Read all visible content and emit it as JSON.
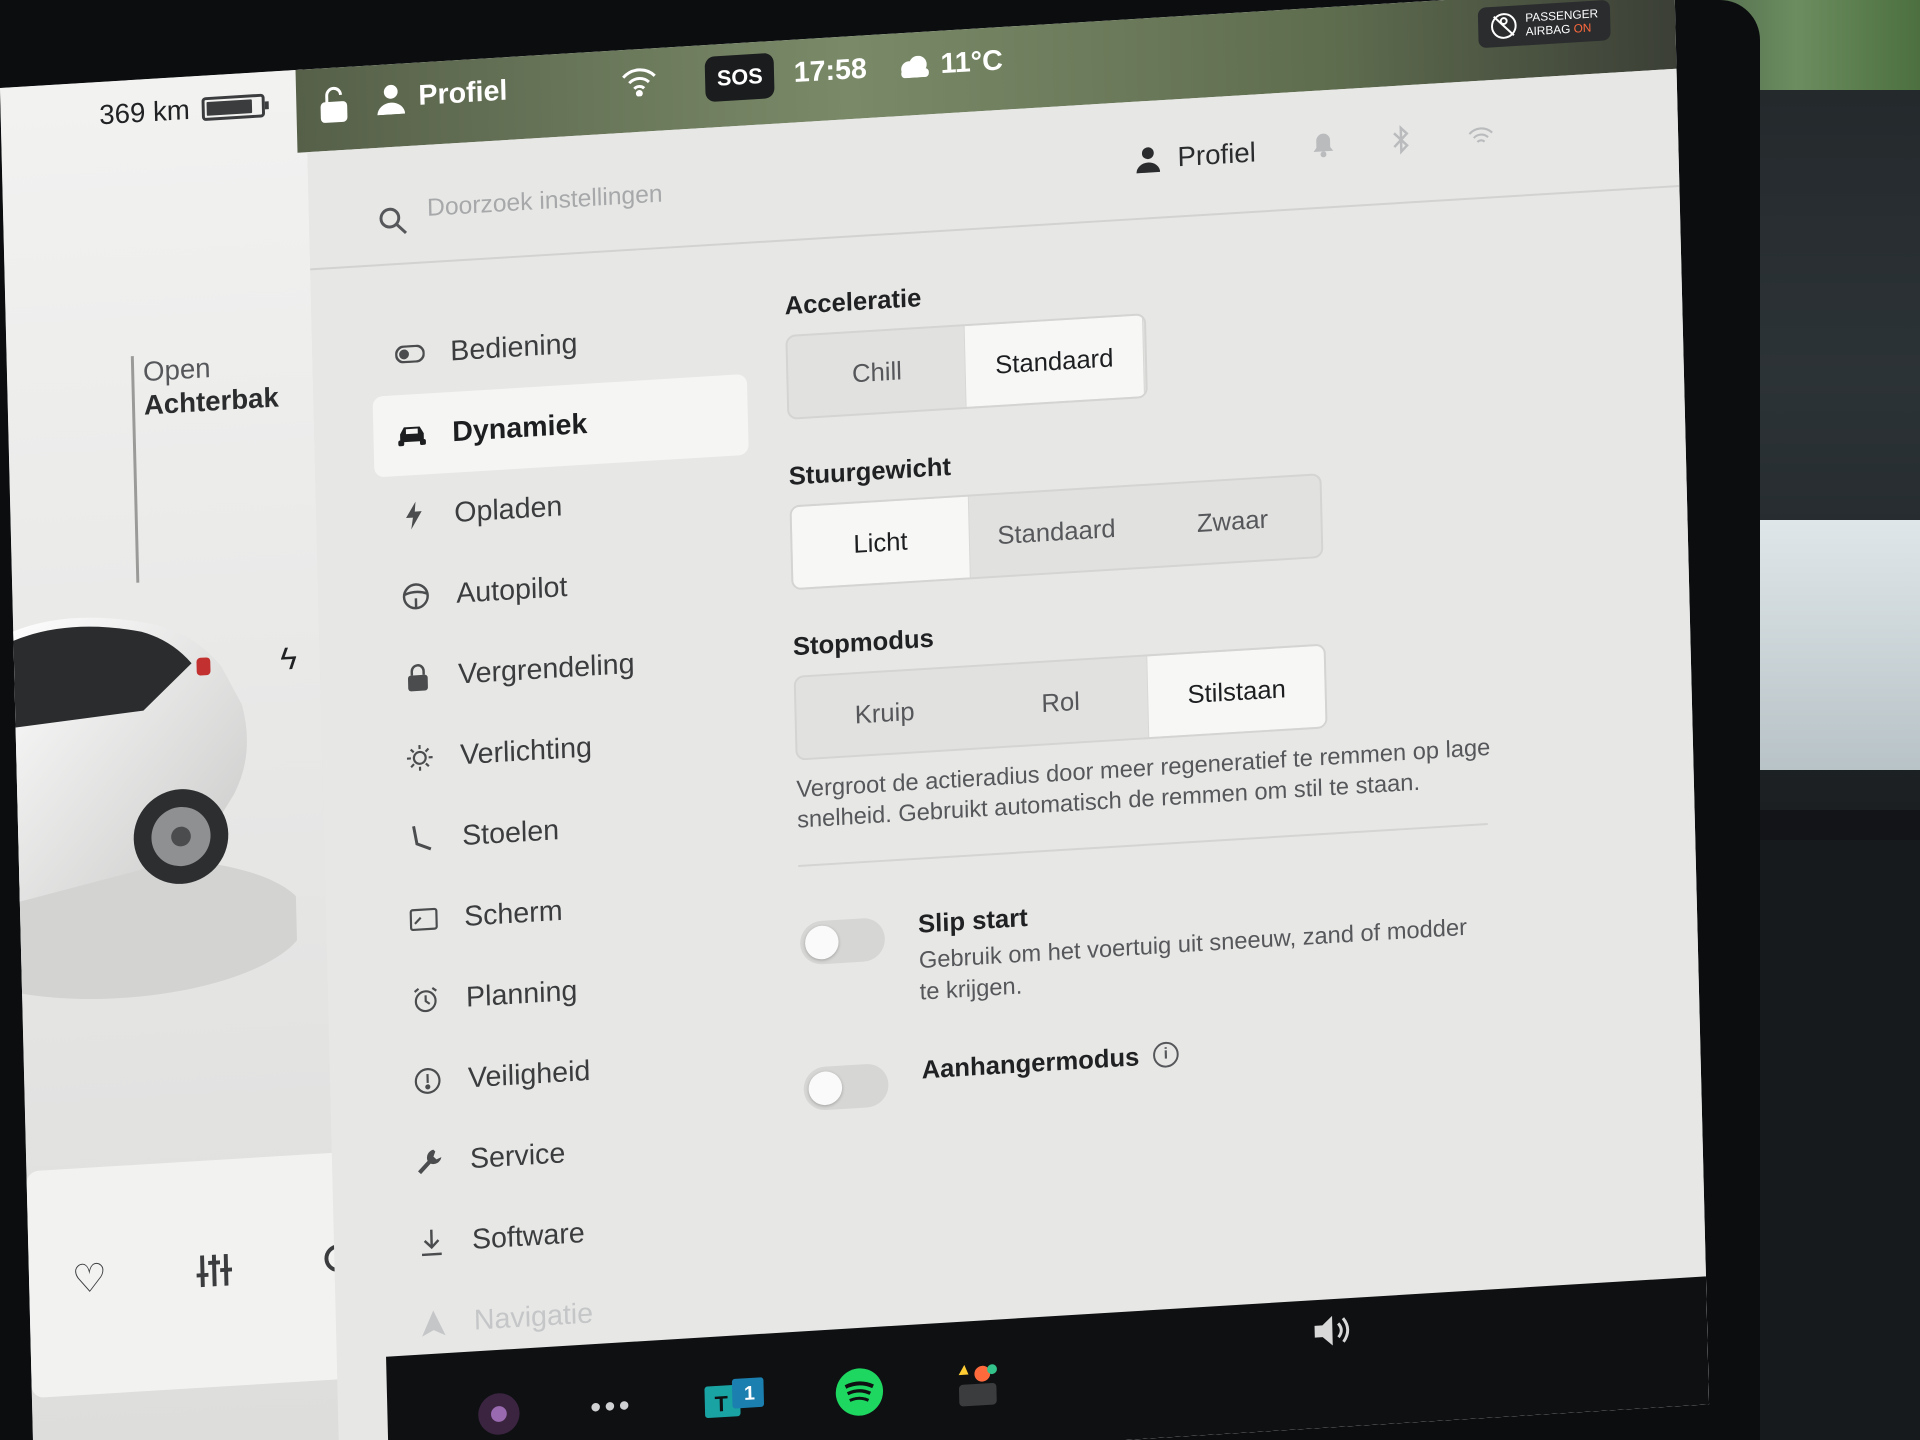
{
  "status_bar": {
    "profile_label": "Profiel",
    "sos_label": "SOS",
    "time": "17:58",
    "temperature": "11°C",
    "airbag_line1": "PASSENGER",
    "airbag_line2": "AIRBAG",
    "airbag_state": "ON"
  },
  "vehicle": {
    "range": "369 km",
    "trunk_line1": "Open",
    "trunk_line2": "Achterbak"
  },
  "search": {
    "placeholder": "Doorzoek instellingen"
  },
  "header": {
    "profile_label": "Profiel"
  },
  "menu": {
    "items": [
      {
        "label": "Bediening",
        "icon": "toggle-icon"
      },
      {
        "label": "Dynamiek",
        "icon": "car-icon",
        "active": true
      },
      {
        "label": "Opladen",
        "icon": "bolt-icon"
      },
      {
        "label": "Autopilot",
        "icon": "steering-wheel-icon"
      },
      {
        "label": "Vergrendeling",
        "icon": "lock-icon"
      },
      {
        "label": "Verlichting",
        "icon": "light-icon"
      },
      {
        "label": "Stoelen",
        "icon": "seat-icon"
      },
      {
        "label": "Scherm",
        "icon": "screen-icon"
      },
      {
        "label": "Planning",
        "icon": "alarm-icon"
      },
      {
        "label": "Veiligheid",
        "icon": "safety-icon"
      },
      {
        "label": "Service",
        "icon": "wrench-icon"
      },
      {
        "label": "Software",
        "icon": "download-icon"
      },
      {
        "label": "Navigatie",
        "icon": "navigation-icon"
      }
    ]
  },
  "dynamics": {
    "acceleration": {
      "label": "Acceleratie",
      "options": [
        "Chill",
        "Standaard"
      ],
      "selected": "Standaard"
    },
    "steering": {
      "label": "Stuurgewicht",
      "options": [
        "Licht",
        "Standaard",
        "Zwaar"
      ],
      "selected": "Licht"
    },
    "stop_mode": {
      "label": "Stopmodus",
      "options": [
        "Kruip",
        "Rol",
        "Stilstaan"
      ],
      "selected": "Stilstaan",
      "description": "Vergroot de actieradius door meer regeneratief te remmen op lage snelheid. Gebruikt automatisch de remmen om stil te staan."
    },
    "slip_start": {
      "label": "Slip start",
      "description": "Gebruik om het voertuig uit sneeuw, zand of modder te krijgen.",
      "enabled": false
    },
    "trailer_mode": {
      "label": "Aanhangermodus",
      "enabled": false
    }
  },
  "colors": {
    "screen_bg": "#e7e7e5",
    "selected_bg": "#f7f7f6",
    "airbag_on": "#ff6a3d",
    "spotify": "#1ed760",
    "teams": "#1aa3a3"
  }
}
